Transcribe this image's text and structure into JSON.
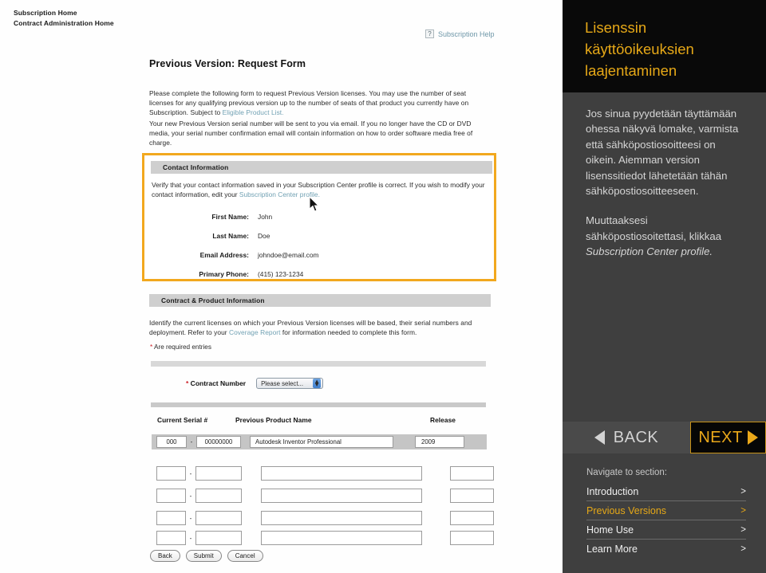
{
  "breadcrumbs": [
    "Subscription Home",
    "Contract Administration Home"
  ],
  "header": {
    "help_icon": "question-mark-icon",
    "help_link": "Subscription Help"
  },
  "form": {
    "title": "Previous Version: Request Form",
    "intro_1_a": "Please complete the following form to request Previous Version licenses. You may use the number of seat licenses for any qualifying previous version up to the number of seats of that product you currently have on Subscription. Subject to ",
    "intro_1_link": "Eligible Product List.",
    "intro_2": "Your new Previous Version serial number will be sent to you via email. If you no longer have the CD or DVD media, your serial number confirmation email will contain information on how to order software media free of charge.",
    "contact_section": {
      "heading": "Contact Information",
      "description_a": "Verify that your contact information saved in your Subscription Center profile is correct. If you wish to modify your contact information, edit your ",
      "description_link": "Subscription Center profile.",
      "fields": [
        {
          "label": "First Name:",
          "value": "John"
        },
        {
          "label": "Last Name:",
          "value": "Doe"
        },
        {
          "label": "Email Address:",
          "value": "johndoe@email.com"
        },
        {
          "label": "Primary Phone:",
          "value": "(415) 123-1234"
        }
      ]
    },
    "contract_section": {
      "heading": "Contract & Product Information",
      "description_a": "Identify the current licenses on which your Previous Version licenses will be based, their serial numbers and deployment. Refer to your ",
      "description_link": "Coverage Report",
      "description_b": " for information needed to complete this form.",
      "required_note_star": "*",
      "required_note": " Are required entries",
      "contract_number_star": "*",
      "contract_number_label": " Contract Number",
      "contract_select_value": "Please select...",
      "columns": [
        "Current Serial #",
        "Previous Product Name",
        "Release"
      ],
      "filled_row": {
        "serial_prefix": "000",
        "serial_dash": "-",
        "serial_suffix": "00000000",
        "product_name": "Autodesk Inventor Professional",
        "release": "2009"
      },
      "empty_rows": 4,
      "empty_dash": "-"
    },
    "buttons": [
      "Back",
      "Submit",
      "Cancel"
    ]
  },
  "sidebar": {
    "title": "Lisenssin käyttöoikeuksien laajentaminen",
    "paragraph_1": "Jos sinua pyydetään täyttämään ohessa näkyvä lomake, varmista että sähköpostiosoitteesi on oikein. Aiemman version lisenssitiedot lähetetään tähän sähköpostiosoitteeseen.",
    "paragraph_2_a": "Muuttaaksesi sähköpostiosoitettasi, klikkaa ",
    "paragraph_2_em": "Subscription Center profile.",
    "back_label": "BACK",
    "next_label": "NEXT",
    "nav_caption": "Navigate to section:",
    "nav_items": [
      {
        "label": "Introduction",
        "chevron": ">",
        "active": false
      },
      {
        "label": "Previous Versions",
        "chevron": ">",
        "active": true
      },
      {
        "label": "Home Use",
        "chevron": ">",
        "active": false
      },
      {
        "label": "Learn More",
        "chevron": ">",
        "active": false
      }
    ]
  },
  "colors": {
    "accent_gold": "#e6a817",
    "sidebar_bg": "#3f3f3f",
    "title_bg": "#090909",
    "highlight_border": "#f2a81e",
    "link_blue": "#72a2b4"
  }
}
